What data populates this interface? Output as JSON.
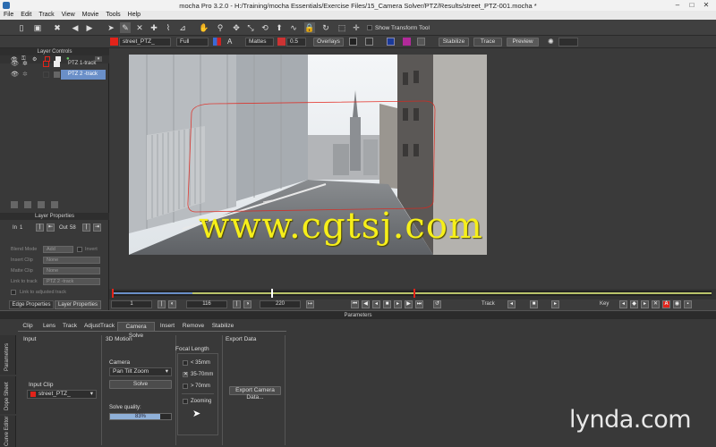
{
  "window": {
    "title": "mocha Pro 3.2.0 - H:/Training/mocha Essentials/Exercise Files/15_Camera Solver/PTZ/Results/street_PTZ-001.mocha *",
    "minimize": "–",
    "maximize": "□",
    "close": "✕"
  },
  "menu": [
    "File",
    "Edit",
    "Track",
    "View",
    "Movie",
    "Tools",
    "Help"
  ],
  "toolbar": {
    "show_transform_tool": "Show Transform Tool"
  },
  "viewbar": {
    "clip": "street_PTZ_",
    "resolution": "Full",
    "mattes": "Mattes",
    "opacity": "0.5",
    "overlays": "Overlays",
    "stabilize": "Stabilize",
    "trace": "Trace",
    "preview": "Preview"
  },
  "layer_controls": {
    "title": "Layer Controls",
    "layers": [
      {
        "name": "PTZ 1-track",
        "selected": false
      },
      {
        "name": "PTZ 2 -track",
        "selected": true
      }
    ]
  },
  "layer_properties": {
    "title": "Layer Properties",
    "in_label": "In",
    "in_value": "1",
    "out_label": "Out",
    "out_value": "58",
    "blend_mode_label": "Blend Mode",
    "blend_mode_value": "Add",
    "invert_label": "Invert",
    "insert_clip_label": "Insert Clip",
    "insert_clip_value": "None",
    "matte_clip_label": "Matte Clip",
    "matte_clip_value": "None",
    "link_to_track_label": "Link to track",
    "link_to_track_value": "PTZ 2 -track",
    "link_to_adjusted": "Link to adjusted track",
    "tab_edge": "Edge Properties",
    "tab_layer": "Layer Properties"
  },
  "transport": {
    "frame_start": "1",
    "frame_current": "116",
    "frame_end": "220",
    "track_label": "Track",
    "key_label": "Key"
  },
  "parameters": {
    "title": "Parameters",
    "tabs": [
      "Clip",
      "Lens",
      "Track",
      "AdjustTrack",
      "Camera Solve",
      "Insert",
      "Remove",
      "Stabilize"
    ],
    "active_tab": "Camera Solve",
    "side_tabs": [
      "Parameters",
      "Dope Sheet",
      "Curve Editor"
    ],
    "input_title": "Input",
    "input_clip_label": "Input Clip",
    "input_clip_value": "street_PTZ_",
    "motion_title": "3D Motion",
    "camera_label": "Camera",
    "camera_value": "Pan Tilt Zoom",
    "solve_button": "Solve",
    "solve_quality_label": "Solve quality:",
    "solve_quality_value": "83%",
    "solve_quality_fraction": 0.83,
    "focal_title": "Focal Length",
    "focal_options": [
      {
        "label": "< 35mm",
        "checked": false
      },
      {
        "label": "35-70mm",
        "checked": true
      },
      {
        "label": "> 70mm",
        "checked": false
      }
    ],
    "zooming_label": "Zooming",
    "export_title": "Export Data",
    "export_button": "Export Camera Data..."
  },
  "watermark": "www.cgtsj.com",
  "brand": "lynda.com",
  "colors": {
    "accent_red": "#e2231a",
    "selection_blue": "#6a8fc8",
    "watermark_yellow": "#f6ef1a"
  }
}
